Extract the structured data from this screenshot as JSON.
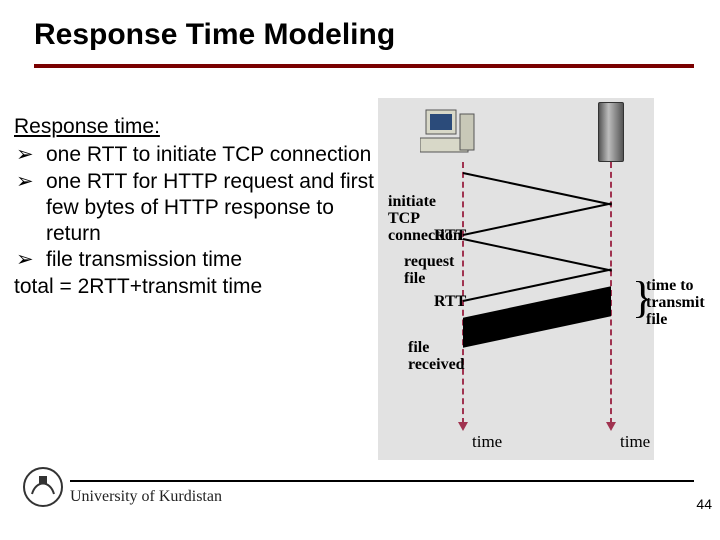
{
  "title": "Response Time Modeling",
  "heading": "Response time:",
  "bullets": [
    "one RTT to initiate TCP connection",
    "one RTT for HTTP request and first few bytes of HTTP response to return",
    "file transmission time"
  ],
  "total_line": "total = 2RTT+transmit time",
  "diagram": {
    "initiate": "initiate TCP connection",
    "rtt1": "RTT",
    "request": "request file",
    "rtt2": "RTT",
    "file_received": "file received",
    "time_to_transmit": "time to transmit file",
    "axis_time_client": "time",
    "axis_time_server": "time"
  },
  "footer": {
    "university": "University of Kurdistan",
    "page": "44"
  },
  "bullet_glyph": "➢"
}
